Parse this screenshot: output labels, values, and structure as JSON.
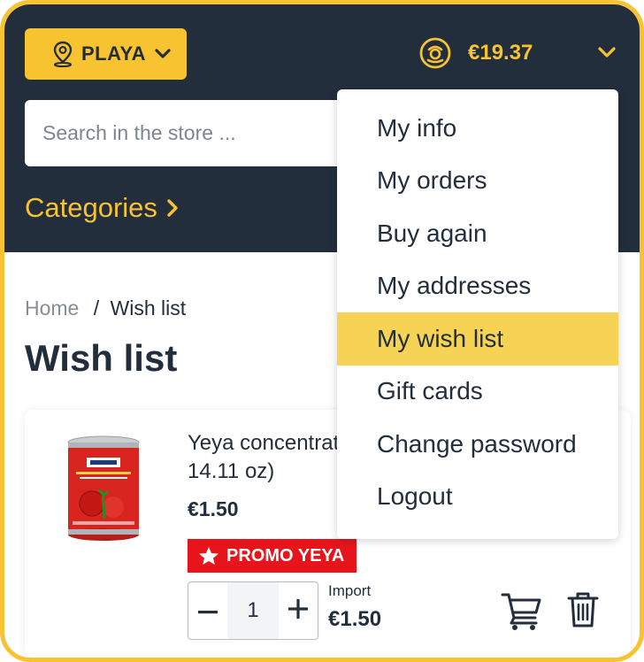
{
  "header": {
    "location_label": "PLAYA",
    "wallet_balance": "€19.37",
    "search_placeholder": "Search in the store ...",
    "categories_label": "Categories"
  },
  "breadcrumb": {
    "home": "Home",
    "separator": "/",
    "current": "Wish list"
  },
  "page_title": "Wish list",
  "product": {
    "name_line1": "Yeya concentrat",
    "name_line2": "14.11 oz)",
    "price": "€1.50",
    "promo_label": "PROMO YEYA",
    "quantity": "1",
    "import_label": "Import",
    "import_price": "€1.50"
  },
  "account_menu": {
    "items": [
      "My info",
      "My orders",
      "Buy again",
      "My addresses",
      "My wish list",
      "Gift cards",
      "Change password",
      "Logout"
    ],
    "active_item": "My wish list"
  },
  "colors": {
    "brand_yellow": "#f7c331",
    "header_navy": "#232e3c",
    "promo_red": "#e8141c",
    "menu_highlight": "#f7d355"
  },
  "icons": [
    "location-pin-icon",
    "chevron-down-icon",
    "wallet-coin-icon",
    "chevron-right-icon",
    "star-icon",
    "minus-icon",
    "plus-icon",
    "cart-icon",
    "trash-icon"
  ]
}
